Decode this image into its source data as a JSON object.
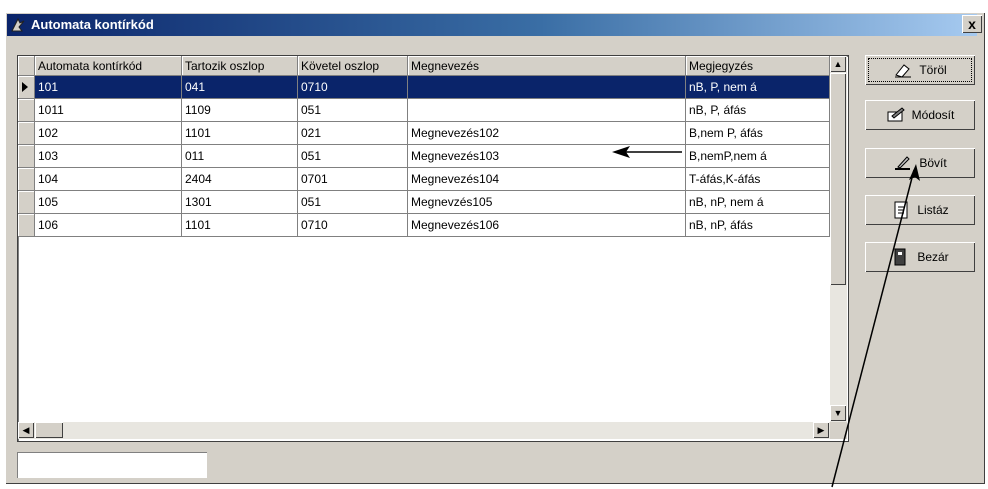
{
  "window": {
    "title": "Automata kontírkód",
    "close_glyph": "x"
  },
  "grid": {
    "columns": [
      "Automata kontírkód",
      "Tartozik oszlop",
      "Követel oszlop",
      "Megnevezés",
      "Megjegyzés"
    ],
    "rows": [
      [
        "101",
        "041",
        "0710",
        "",
        "nB, P, nem á"
      ],
      [
        "1011",
        "1109",
        "051",
        "",
        "nB, P, áfás"
      ],
      [
        "102",
        "1101",
        "021",
        "Megnevezés102",
        "B,nem P, áfás"
      ],
      [
        "103",
        "011",
        "051",
        "Megnevezés103",
        "B,nemP,nem á"
      ],
      [
        "104",
        "2404",
        "0701",
        "Megnevezés104",
        "T-áfás,K-áfás"
      ],
      [
        "105",
        "1301",
        "051",
        "Megnevzés105",
        "nB, nP, nem á"
      ],
      [
        "106",
        "1101",
        "0710",
        "Megnevezés106",
        "nB, nP, áfás"
      ]
    ],
    "selected_row": 0
  },
  "buttons": {
    "torol": "Töröl",
    "modosit": "Módosít",
    "bovit": "Bövít",
    "listaz": "Listáz",
    "bezar": "Bezár"
  },
  "status_value": "",
  "colors": {
    "title_start": "#0a246a",
    "title_end": "#a6caf0",
    "selection": "#0a246a",
    "face": "#d4d0c8"
  },
  "icons": [
    "app-icon",
    "close-icon",
    "eraser-icon",
    "edit-icon",
    "add-icon",
    "list-icon",
    "exit-icon",
    "arrow-annotation"
  ]
}
